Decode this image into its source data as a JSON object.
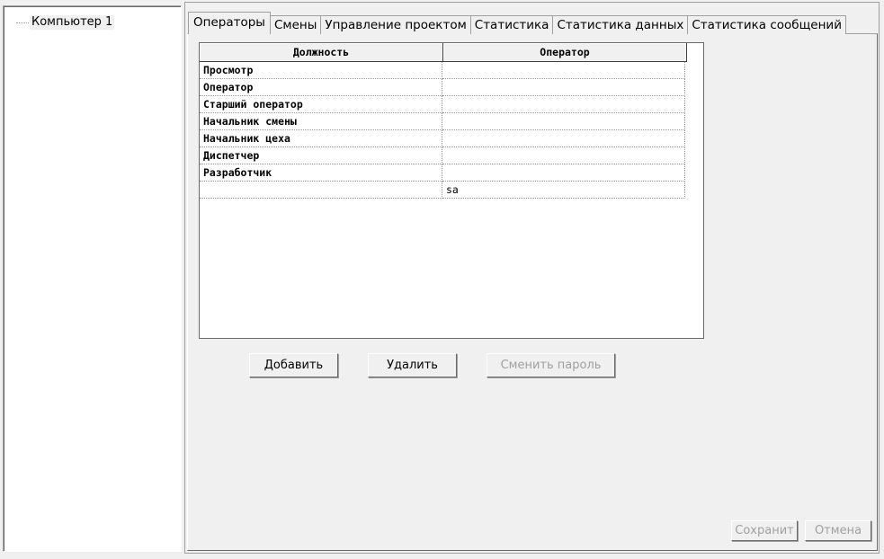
{
  "tree": {
    "root_label": "Компьютер 1"
  },
  "tabs": [
    {
      "label": "Операторы",
      "active": true
    },
    {
      "label": "Смены"
    },
    {
      "label": "Управление проектом"
    },
    {
      "label": "Статистика"
    },
    {
      "label": "Статистика данных"
    },
    {
      "label": "Статистика сообщений"
    }
  ],
  "grid": {
    "columns": [
      "Должность",
      "Оператор"
    ],
    "rows": [
      [
        "Просмотр",
        ""
      ],
      [
        "Оператор",
        ""
      ],
      [
        "Старший оператор",
        ""
      ],
      [
        "Начальник смены",
        ""
      ],
      [
        "Начальник цеха",
        ""
      ],
      [
        "Диспетчер",
        ""
      ],
      [
        "Разработчик",
        ""
      ],
      [
        "",
        "sa"
      ]
    ]
  },
  "buttons": {
    "add": "Добавить",
    "delete": "Удалить",
    "change_password": "Сменить пароль",
    "save": "Сохранит",
    "cancel": "Отмена"
  }
}
